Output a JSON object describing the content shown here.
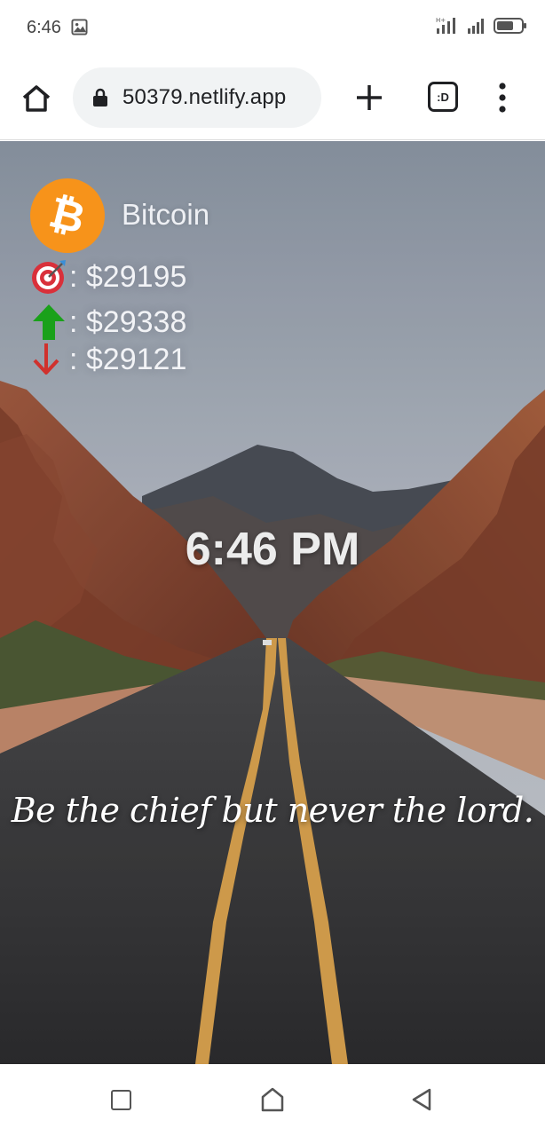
{
  "status_bar": {
    "time": "6:46"
  },
  "browser": {
    "url": "50379.netlify.app",
    "tabs_label": ":D"
  },
  "crypto": {
    "name": "Bitcoin",
    "symbol_glyph": "₿",
    "current_price": ": $29195",
    "high_price": ": $29338",
    "low_price": ": $29121"
  },
  "clock": {
    "time": "6:46 PM"
  },
  "quote": {
    "text": "Be the chief but never the lord."
  },
  "colors": {
    "bitcoin_orange": "#f7931a",
    "up_arrow": "#1aa11a",
    "down_arrow": "#d0312d"
  },
  "icons": [
    "home-icon",
    "lock-icon",
    "plus-icon",
    "tab-switcher-icon",
    "more-vert-icon",
    "target-icon",
    "up-arrow-icon",
    "down-arrow-icon",
    "square-icon",
    "circle-home-icon",
    "triangle-back-icon"
  ]
}
